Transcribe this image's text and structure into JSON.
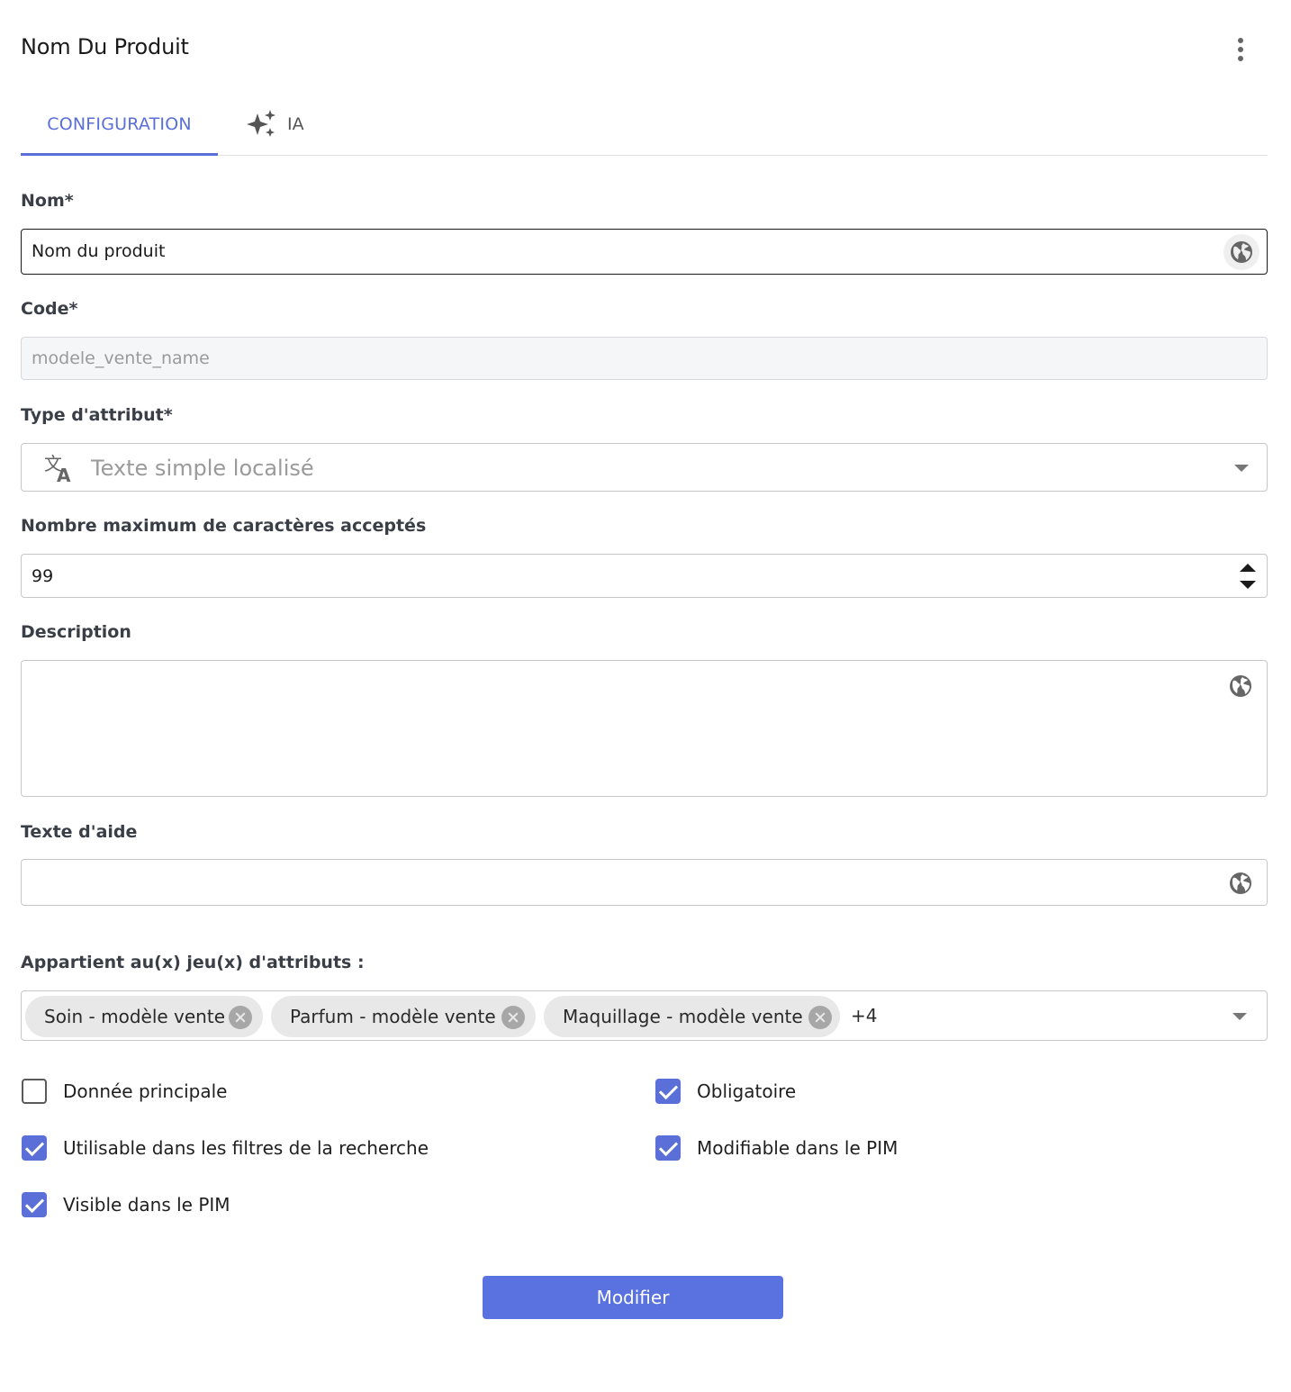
{
  "header": {
    "title": "Nom Du Produit",
    "menu_icon": "more-vert-icon"
  },
  "tabs": [
    {
      "label": "CONFIGURATION",
      "active": true
    },
    {
      "label": "IA",
      "icon": "sparkles-icon",
      "active": false
    }
  ],
  "form": {
    "name": {
      "label": "Nom*",
      "value": "Nom du produit",
      "icon": "globe-icon"
    },
    "code": {
      "label": "Code*",
      "placeholder": "modele_vente_name"
    },
    "attribute_type": {
      "label": "Type d'attribut*",
      "value": "Texte simple localisé",
      "icon": "translate-icon"
    },
    "max_chars": {
      "label": "Nombre maximum de caractères acceptés",
      "value": "99"
    },
    "description": {
      "label": "Description",
      "value": "",
      "icon": "globe-icon"
    },
    "help_text": {
      "label": "Texte d'aide",
      "value": "",
      "icon": "globe-icon"
    },
    "attribute_sets": {
      "label": "Appartient au(x) jeu(x) d'attributs :",
      "chips": [
        "Soin - modèle vente",
        "Parfum - modèle vente",
        "Maquillage - modèle vente"
      ],
      "more": "+4"
    }
  },
  "checkboxes": [
    {
      "label": "Donnée principale",
      "checked": false
    },
    {
      "label": "Obligatoire",
      "checked": true
    },
    {
      "label": "Utilisable dans les filtres de la recherche",
      "checked": true
    },
    {
      "label": "Modifiable dans le PIM",
      "checked": true
    },
    {
      "label": "Visible dans le PIM",
      "checked": true
    }
  ],
  "submit": {
    "label": "Modifier"
  },
  "colors": {
    "accent": "#5a6fd8",
    "button": "#5a72e0",
    "chip_bg": "#e8e8e8"
  }
}
